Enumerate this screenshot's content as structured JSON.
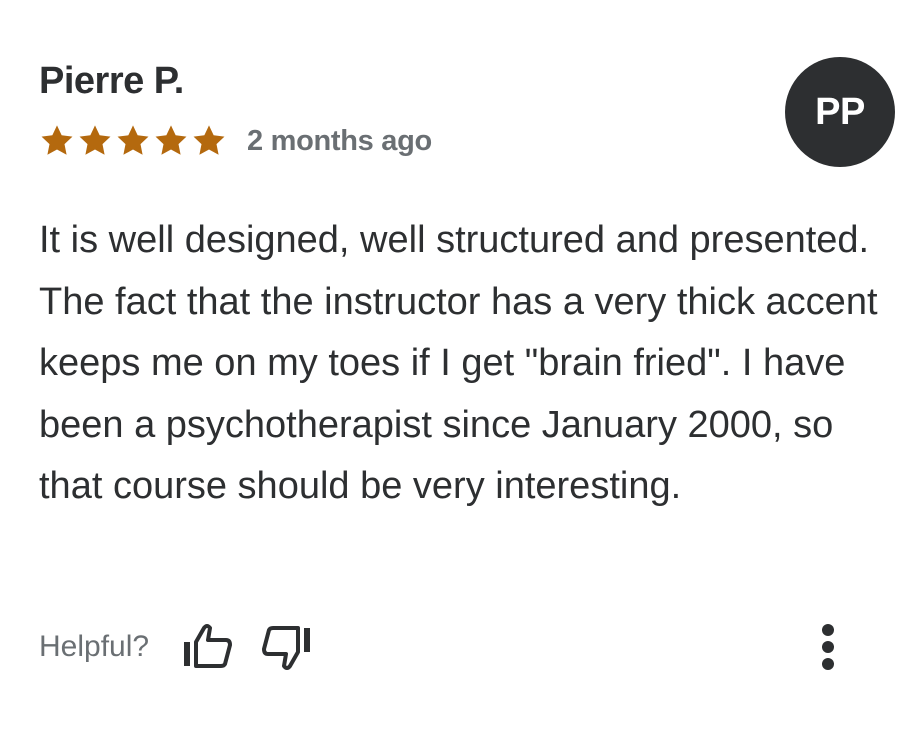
{
  "review": {
    "reviewer_name": "Pierre P.",
    "avatar_initials": "PP",
    "rating": 5,
    "max_rating": 5,
    "date": "2 months ago",
    "text": "It is well designed, well structured and presented. The fact that the instructor has a very thick accent keeps me on my toes if I get \"brain fried\". I have been a psychotherapist since January 2000, so that course should be very interesting."
  },
  "footer": {
    "helpful_label": "Helpful?",
    "thumbs_up_icon": "thumbs-up-icon",
    "thumbs_down_icon": "thumbs-down-icon",
    "more_icon": "more-vertical-icon"
  },
  "colors": {
    "star": "#b4690e",
    "text": "#2d2f31",
    "muted": "#6a6f73",
    "avatar_bg": "#2d2f31"
  }
}
